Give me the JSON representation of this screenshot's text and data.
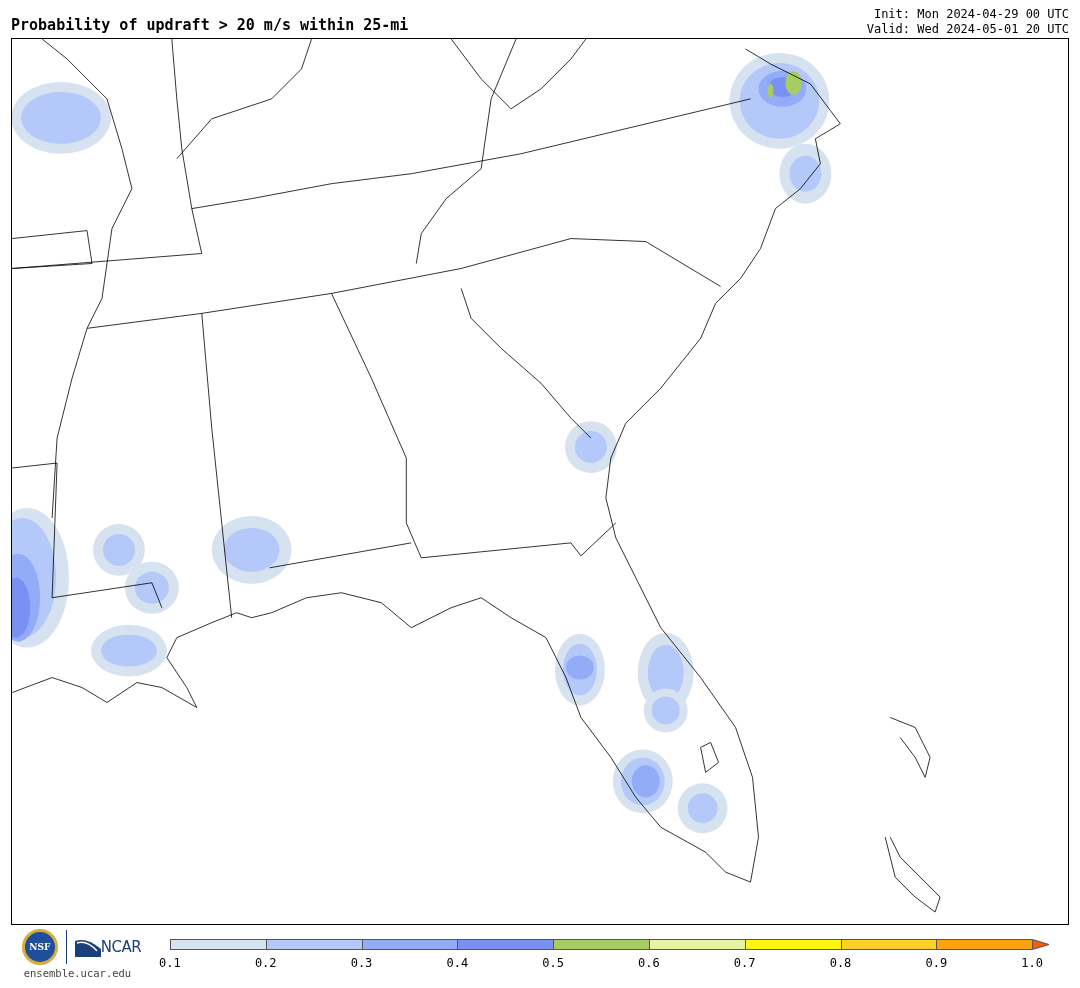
{
  "title": "Probability of updraft > 20 m/s within 25-mi",
  "init": "Init: Mon 2024-04-29 00 UTC",
  "valid": "Valid: Wed 2024-05-01 20 UTC",
  "logos": {
    "seal_text": "NSF",
    "brand_text": "NCAR",
    "url": "ensemble.ucar.edu"
  },
  "colorbar": {
    "segments": [
      {
        "kind": "block",
        "color": "#d6e2f0"
      },
      {
        "kind": "block",
        "color": "#b4c8fa"
      },
      {
        "kind": "block",
        "color": "#92acf8"
      },
      {
        "kind": "block",
        "color": "#7a90f2"
      },
      {
        "kind": "block",
        "color": "#a8cc64"
      },
      {
        "kind": "block",
        "color": "#e6f4a4"
      },
      {
        "kind": "block",
        "color": "#fff614"
      },
      {
        "kind": "block",
        "color": "#ffd026"
      },
      {
        "kind": "block",
        "color": "#ffa210"
      },
      {
        "kind": "arrow",
        "color": "#f45a10"
      }
    ],
    "ticks": [
      "0.1",
      "0.2",
      "0.3",
      "0.4",
      "0.5",
      "0.6",
      "0.7",
      "0.8",
      "0.9",
      "1.0"
    ]
  }
}
